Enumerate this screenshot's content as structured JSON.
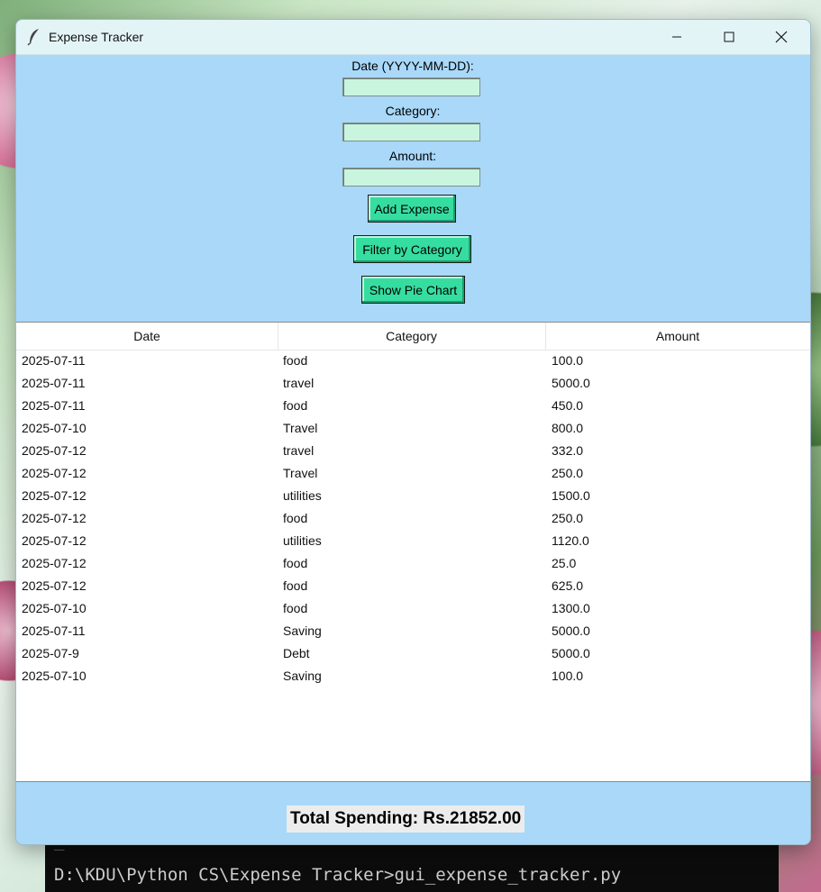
{
  "window": {
    "title": "Expense Tracker"
  },
  "form": {
    "date_label": "Date (YYYY-MM-DD):",
    "category_label": "Category:",
    "amount_label": "Amount:",
    "date_value": "",
    "category_value": "",
    "amount_value": "",
    "add_button": "Add Expense",
    "filter_button": "Filter by Category",
    "pie_button": "Show Pie Chart"
  },
  "table": {
    "columns": [
      "Date",
      "Category",
      "Amount"
    ],
    "rows": [
      [
        "2025-07-11",
        "food",
        "100.0"
      ],
      [
        "2025-07-11",
        "travel",
        "5000.0"
      ],
      [
        "2025-07-11",
        "food",
        "450.0"
      ],
      [
        "2025-07-10",
        "Travel",
        "800.0"
      ],
      [
        "2025-07-12",
        "travel",
        "332.0"
      ],
      [
        "2025-07-12",
        "Travel",
        "250.0"
      ],
      [
        "2025-07-12",
        "utilities",
        "1500.0"
      ],
      [
        "2025-07-12",
        "food",
        "250.0"
      ],
      [
        "2025-07-12",
        "utilities",
        "1120.0"
      ],
      [
        "2025-07-12",
        "food",
        "25.0"
      ],
      [
        "2025-07-12",
        "food",
        "625.0"
      ],
      [
        "2025-07-10",
        "food",
        "1300.0"
      ],
      [
        "2025-07-11",
        "Saving",
        "5000.0"
      ],
      [
        "2025-07-9",
        "Debt",
        "5000.0"
      ],
      [
        "2025-07-10",
        "Saving",
        "100.0"
      ]
    ]
  },
  "footer": {
    "total_text": "Total Spending: Rs.21852.00"
  },
  "terminal": {
    "prompt_line": "D:\\KDU\\Python CS\\Expense Tracker>gui_expense_tracker.py"
  },
  "colors": {
    "window_bg": "#a9d8f9",
    "entry_bg": "#c9f5df",
    "button_bg": "#35dea0",
    "titlebar_bg": "#e3f4f7"
  }
}
